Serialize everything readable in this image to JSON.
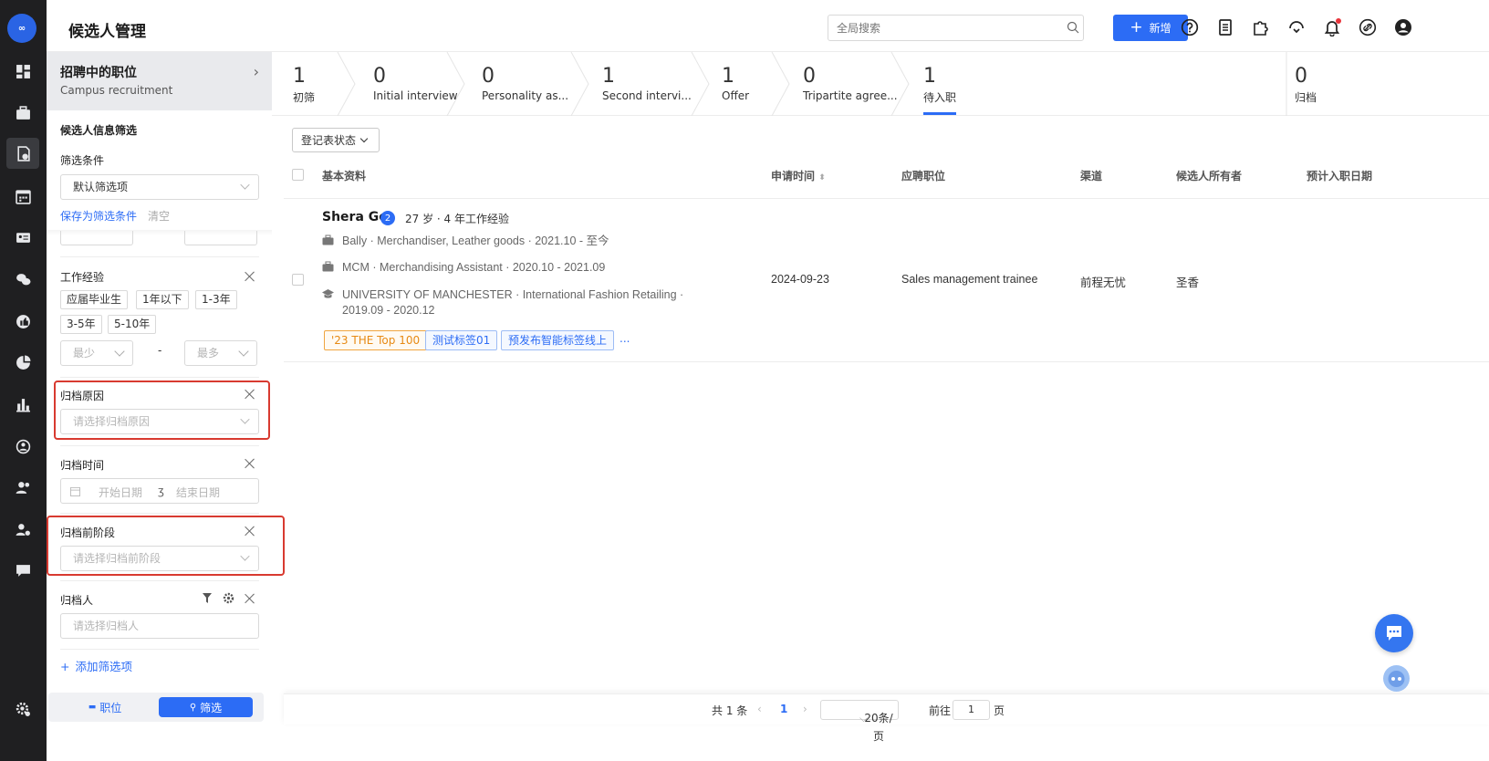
{
  "header": {
    "title": "候选人管理",
    "search_placeholder": "全局搜索",
    "add_label": "新增"
  },
  "left_panel": {
    "position": {
      "title": "招聘中的职位",
      "subtitle": "Campus recruitment"
    },
    "filter_section_title": "候选人信息筛选",
    "filter_condition_label": "筛选条件",
    "filter_condition_value": "默认筛选项",
    "save_filter_label": "保存为筛选条件",
    "clear_label": "清空",
    "work_exp": {
      "label": "工作经验",
      "options": [
        "应届毕业生",
        "1年以下",
        "1-3年",
        "3-5年",
        "5-10年"
      ],
      "min_placeholder": "最少",
      "max_placeholder": "最多",
      "dash": "-"
    },
    "archive_reason": {
      "label": "归档原因",
      "placeholder": "请选择归档原因"
    },
    "archive_time": {
      "label": "归档时间",
      "start_placeholder": "开始日期",
      "end_placeholder": "结束日期"
    },
    "archive_stage": {
      "label": "归档前阶段",
      "placeholder": "请选择归档前阶段"
    },
    "archiver": {
      "label": "归档人",
      "placeholder": "请选择归档人"
    },
    "add_filter_label": "添加筛选项",
    "bottom_tabs": {
      "positions": "职位",
      "filter": "筛选"
    }
  },
  "stages": [
    {
      "count": "1",
      "label": "初筛"
    },
    {
      "count": "0",
      "label": "Initial interview"
    },
    {
      "count": "0",
      "label": "Personality as..."
    },
    {
      "count": "1",
      "label": "Second intervi..."
    },
    {
      "count": "1",
      "label": "Offer"
    },
    {
      "count": "0",
      "label": "Tripartite agree..."
    },
    {
      "count": "1",
      "label": "待入职"
    },
    {
      "count": "0",
      "label": "归档"
    }
  ],
  "table": {
    "registration_filter": "登记表状态",
    "columns": {
      "basic": "基本资料",
      "apply_time": "申请时间",
      "position": "应聘职位",
      "channel": "渠道",
      "owner": "候选人所有者",
      "onboard_date": "预计入职日期"
    },
    "rows": [
      {
        "name": "Shera Ge",
        "badge": "2",
        "meta": "27 岁 · 4 年工作经验",
        "exp1": "Bally · Merchandiser, Leather goods · 2021.10 - 至今",
        "exp2": "MCM · Merchandising Assistant · 2020.10 - 2021.09",
        "edu_line1": "UNIVERSITY OF MANCHESTER · International Fashion Retailing ·",
        "edu_line2": "2019.09 - 2020.12",
        "tags": [
          "'23 THE Top 100",
          "测试标签01",
          "预发布智能标签线上"
        ],
        "more": "...",
        "apply_time": "2024-09-23",
        "position": "Sales management trainee",
        "channel": "前程无忧",
        "owner": "圣香"
      }
    ]
  },
  "pagination": {
    "total": "共 1 条",
    "current_page": "1",
    "page_size": "20条/页",
    "goto_label": "前往",
    "goto_value": "1",
    "page_suffix": "页"
  },
  "colors": {
    "primary": "#2c6cf5",
    "rail": "#1f1f21",
    "highlight": "#d83a30"
  }
}
